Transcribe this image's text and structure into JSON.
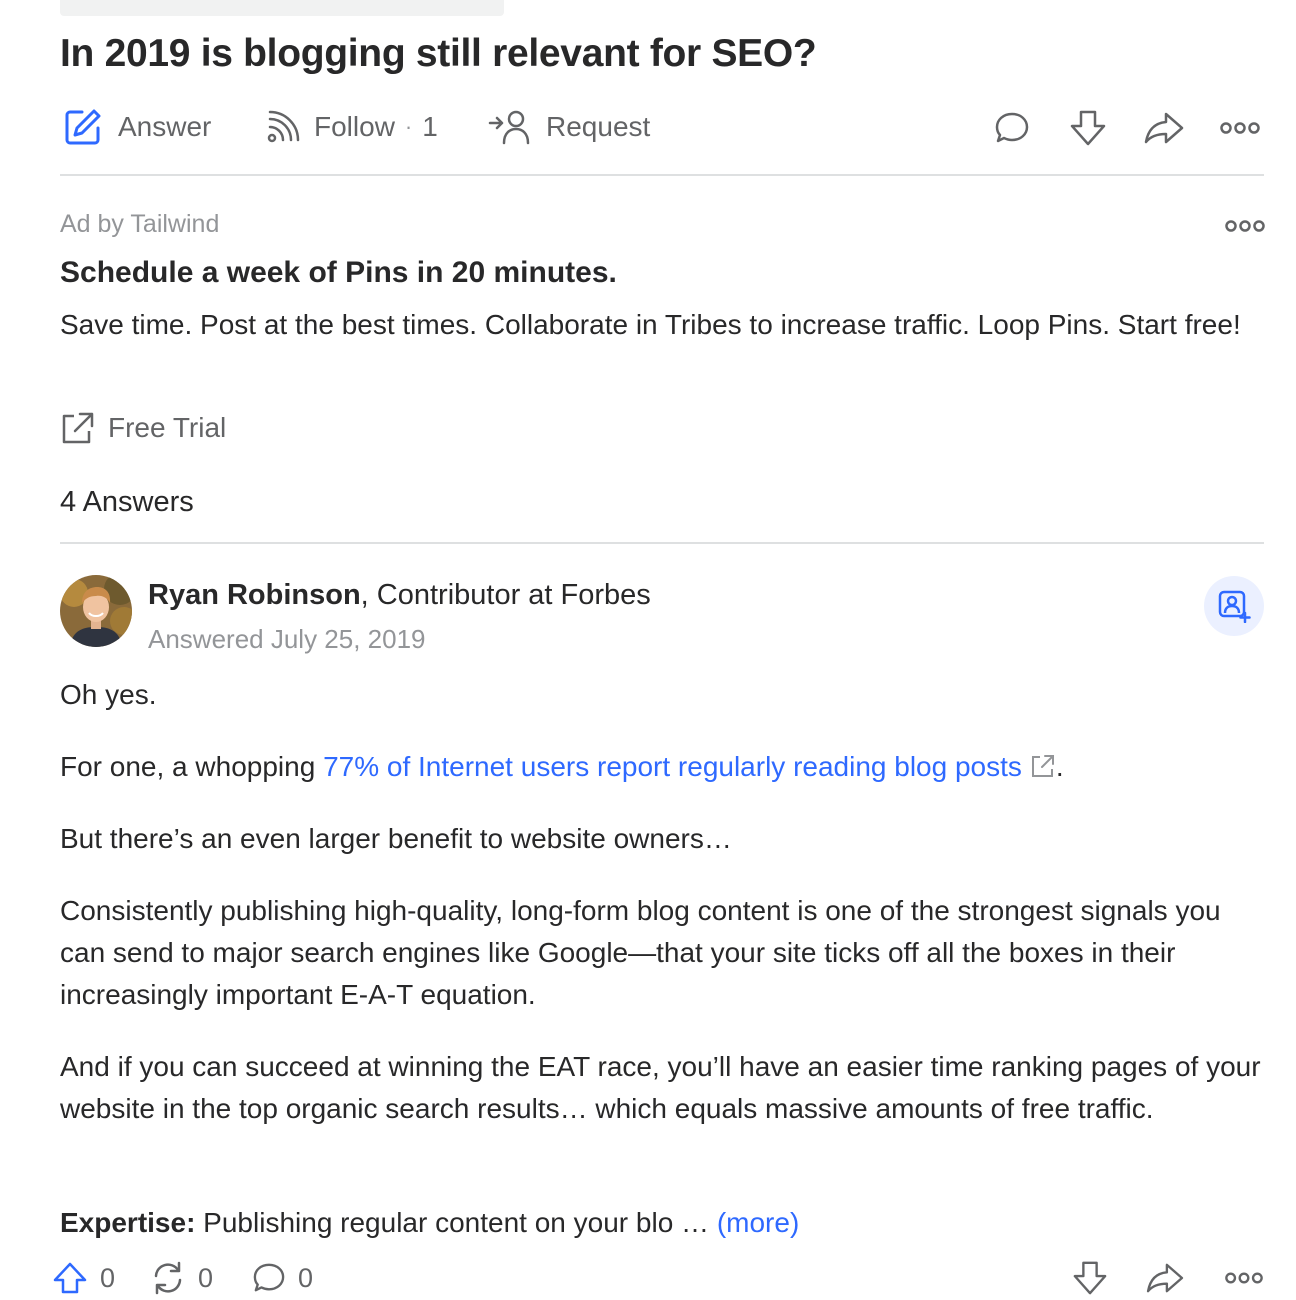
{
  "question": {
    "title": "In 2019 is blogging still relevant for SEO?"
  },
  "actions": {
    "answer_label": "Answer",
    "follow_label": "Follow",
    "follow_separator": "·",
    "follow_count": "1",
    "request_label": "Request",
    "icons": [
      "pen-square-icon",
      "wifi-feed-icon",
      "person-arrow-icon",
      "comment-icon",
      "downvote-icon",
      "share-icon",
      "more-icon"
    ]
  },
  "ad": {
    "label": "Ad by Tailwind",
    "title": "Schedule a week of Pins in 20 minutes.",
    "body": "Save time. Post at the best times. Collaborate in Tribes to increase traffic. Loop Pins. Start free!",
    "cta_label": "Free Trial"
  },
  "answers_header": "4 Answers",
  "answer": {
    "author_name": "Ryan Robinson",
    "author_credential": ", Contributor at Forbes",
    "date": "Answered July 25, 2019",
    "p1": "Oh yes.",
    "p2_prefix": "For one, a whopping ",
    "p2_link": "77% of Internet users report regularly reading blog posts",
    "p2_suffix": ".",
    "p3": "But there’s an even larger benefit to website owners…",
    "p4": "Consistently publishing high-quality, long-form blog content is one of the strongest signals you can send to major search engines like Google—that your site ticks off all the boxes in their increasingly important E-A-T equation.",
    "p5": "And if you can succeed at winning the EAT race, you’ll have an easier time ranking pages of your website in the top organic search results… which equals massive amounts of free traffic.",
    "p6_bold": "Expertise:",
    "p6_text": " Publishing regular content on your blo … ",
    "more_label": "(more)"
  },
  "footer": {
    "upvotes": "0",
    "shares": "0",
    "comments": "0"
  },
  "colors": {
    "accent": "#2e69ff",
    "text": "#282829",
    "secondary": "#636466",
    "muted": "#939598",
    "divider": "#dee0e1"
  }
}
